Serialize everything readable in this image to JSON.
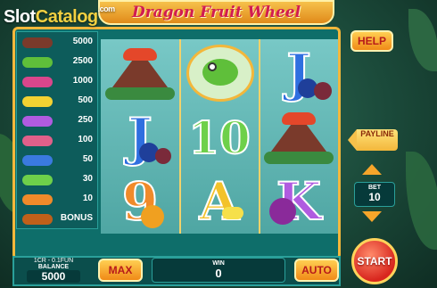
{
  "watermark": {
    "slot": "Slot",
    "catalog": "Catalog",
    "com": ".com"
  },
  "title": "Dragon Fruit Wheel",
  "paytable": [
    {
      "icon": "volcano-icon",
      "color": "#7a3a2b",
      "value": "5000"
    },
    {
      "icon": "chameleon-icon",
      "color": "#5fbf3a",
      "value": "2500"
    },
    {
      "icon": "dragon-fruit-icon",
      "color": "#d9468c",
      "value": "1000"
    },
    {
      "icon": "banana-icon",
      "color": "#f3d232",
      "value": "500"
    },
    {
      "icon": "k-letter-icon",
      "color": "#b05be0",
      "value": "250"
    },
    {
      "icon": "q-letter-icon",
      "color": "#e0608a",
      "value": "100"
    },
    {
      "icon": "j-letter-icon",
      "color": "#3a7ae0",
      "value": "50"
    },
    {
      "icon": "ten-letter-icon",
      "color": "#6ed04a",
      "value": "30"
    },
    {
      "icon": "nine-letter-icon",
      "color": "#f08a2a",
      "value": "10"
    },
    {
      "icon": "bonus-icon",
      "color": "#c0601a",
      "value": "BONUS"
    }
  ],
  "buttons": {
    "help": "HELP",
    "payline": "PAYLINE",
    "max": "MAX",
    "auto": "AUTO",
    "start": "START"
  },
  "bet": {
    "label": "BET",
    "value": "10"
  },
  "balance": {
    "rate": "1CR - 0.1FUN",
    "label": "BALANCE",
    "value": "5000"
  },
  "win": {
    "label": "WIN",
    "value": "0"
  },
  "colors": {
    "frame": "#0e6e6a",
    "gold": "#f3b73b",
    "accent": "#d11c52"
  }
}
